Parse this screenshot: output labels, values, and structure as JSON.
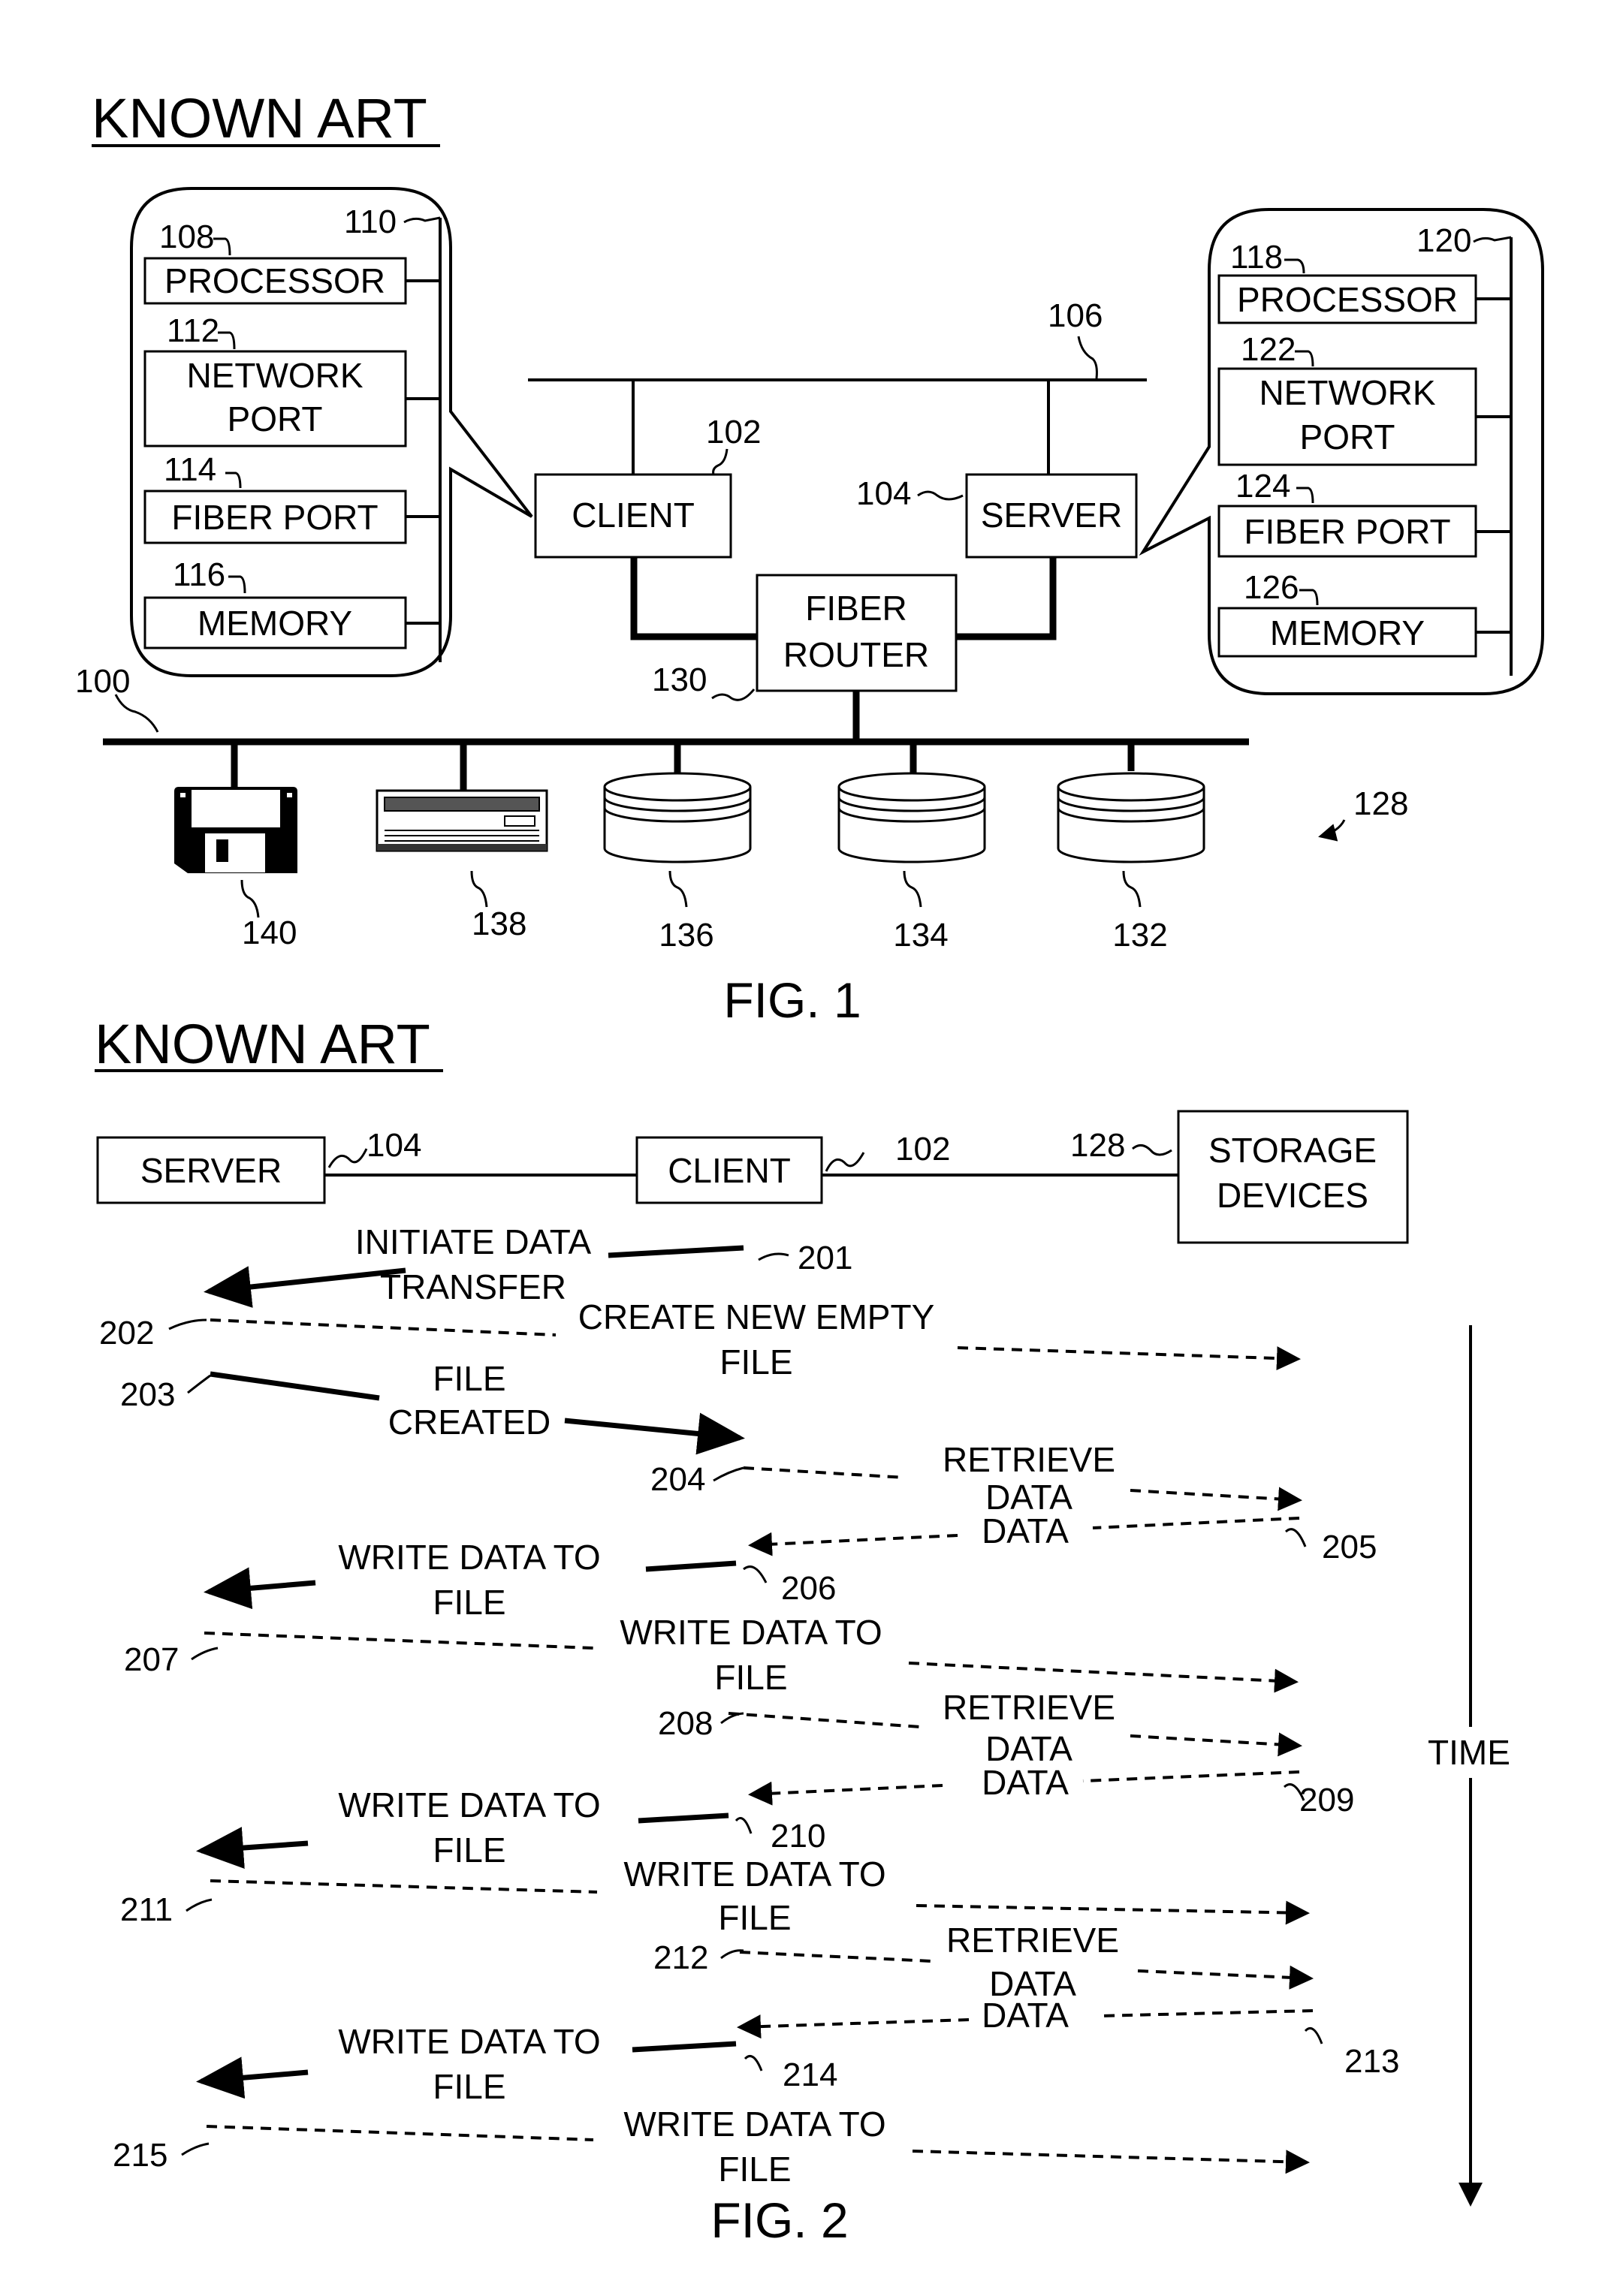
{
  "fig1": {
    "heading": "KNOWN ART",
    "caption": "FIG. 1",
    "client_callout": {
      "bus_ref": "110",
      "items": [
        {
          "ref": "108",
          "lines": [
            "PROCESSOR"
          ]
        },
        {
          "ref": "112",
          "lines": [
            "NETWORK",
            "PORT"
          ]
        },
        {
          "ref": "114",
          "lines": [
            "FIBER PORT"
          ]
        },
        {
          "ref": "116",
          "lines": [
            "MEMORY"
          ]
        }
      ]
    },
    "server_callout": {
      "bus_ref": "120",
      "items": [
        {
          "ref": "118",
          "lines": [
            "PROCESSOR"
          ]
        },
        {
          "ref": "122",
          "lines": [
            "NETWORK",
            "PORT"
          ]
        },
        {
          "ref": "124",
          "lines": [
            "FIBER PORT"
          ]
        },
        {
          "ref": "126",
          "lines": [
            "MEMORY"
          ]
        }
      ]
    },
    "network_ref": "106",
    "client": {
      "label": "CLIENT",
      "ref": "102"
    },
    "server": {
      "label": "SERVER",
      "ref": "104"
    },
    "router": {
      "lines": [
        "FIBER",
        "ROUTER"
      ],
      "ref": "130"
    },
    "san_ref": "100",
    "storage_group_ref": "128",
    "devices": [
      {
        "type": "floppy-disk",
        "ref": "140"
      },
      {
        "type": "tape-drive",
        "ref": "138"
      },
      {
        "type": "disk-storage",
        "ref": "136"
      },
      {
        "type": "disk-storage",
        "ref": "134"
      },
      {
        "type": "disk-storage",
        "ref": "132"
      }
    ]
  },
  "fig2": {
    "heading": "KNOWN ART",
    "caption": "FIG. 2",
    "time_label": "TIME",
    "entities": [
      {
        "label": [
          "SERVER"
        ],
        "ref": "104"
      },
      {
        "label": [
          "CLIENT"
        ],
        "ref": "102"
      },
      {
        "label": [
          "STORAGE",
          "DEVICES"
        ],
        "ref": "128"
      }
    ],
    "messages": [
      {
        "ref": "201",
        "lines": [
          "INITIATE DATA",
          "TRANSFER"
        ],
        "from": "client",
        "to": "server",
        "style": "solid"
      },
      {
        "ref": "202",
        "lines": [
          "CREATE NEW EMPTY",
          "FILE"
        ],
        "from": "server",
        "to": "storage",
        "style": "dashed"
      },
      {
        "ref": "203",
        "lines": [
          "FILE",
          "CREATED"
        ],
        "from": "server",
        "to": "client",
        "style": "solid"
      },
      {
        "ref": "204",
        "lines": [
          "RETRIEVE",
          "DATA"
        ],
        "from": "client",
        "to": "storage",
        "style": "dashed"
      },
      {
        "ref": "205",
        "lines": [
          "DATA"
        ],
        "from": "storage",
        "to": "client",
        "style": "dashed"
      },
      {
        "ref": "206",
        "lines": [
          "WRITE DATA TO",
          "FILE"
        ],
        "from": "client",
        "to": "server",
        "style": "solid"
      },
      {
        "ref": "207",
        "lines": [
          "WRITE DATA TO",
          "FILE"
        ],
        "from": "server",
        "to": "storage",
        "style": "dashed"
      },
      {
        "ref": "208",
        "lines": [
          "RETRIEVE",
          "DATA"
        ],
        "from": "client",
        "to": "storage",
        "style": "dashed"
      },
      {
        "ref": "209",
        "lines": [
          "DATA"
        ],
        "from": "storage",
        "to": "client",
        "style": "dashed"
      },
      {
        "ref": "210",
        "lines": [
          "WRITE DATA TO",
          "FILE"
        ],
        "from": "client",
        "to": "server",
        "style": "solid"
      },
      {
        "ref": "211",
        "lines": [
          "WRITE DATA TO",
          "FILE"
        ],
        "from": "server",
        "to": "storage",
        "style": "dashed"
      },
      {
        "ref": "212",
        "lines": [
          "RETRIEVE",
          "DATA"
        ],
        "from": "client",
        "to": "storage",
        "style": "dashed"
      },
      {
        "ref": "213",
        "lines": [
          "DATA"
        ],
        "from": "storage",
        "to": "client",
        "style": "dashed"
      },
      {
        "ref": "214",
        "lines": [
          "WRITE DATA TO",
          "FILE"
        ],
        "from": "client",
        "to": "server",
        "style": "solid"
      },
      {
        "ref": "215",
        "lines": [
          "WRITE DATA TO",
          "FILE"
        ],
        "from": "server",
        "to": "storage",
        "style": "dashed"
      }
    ]
  }
}
